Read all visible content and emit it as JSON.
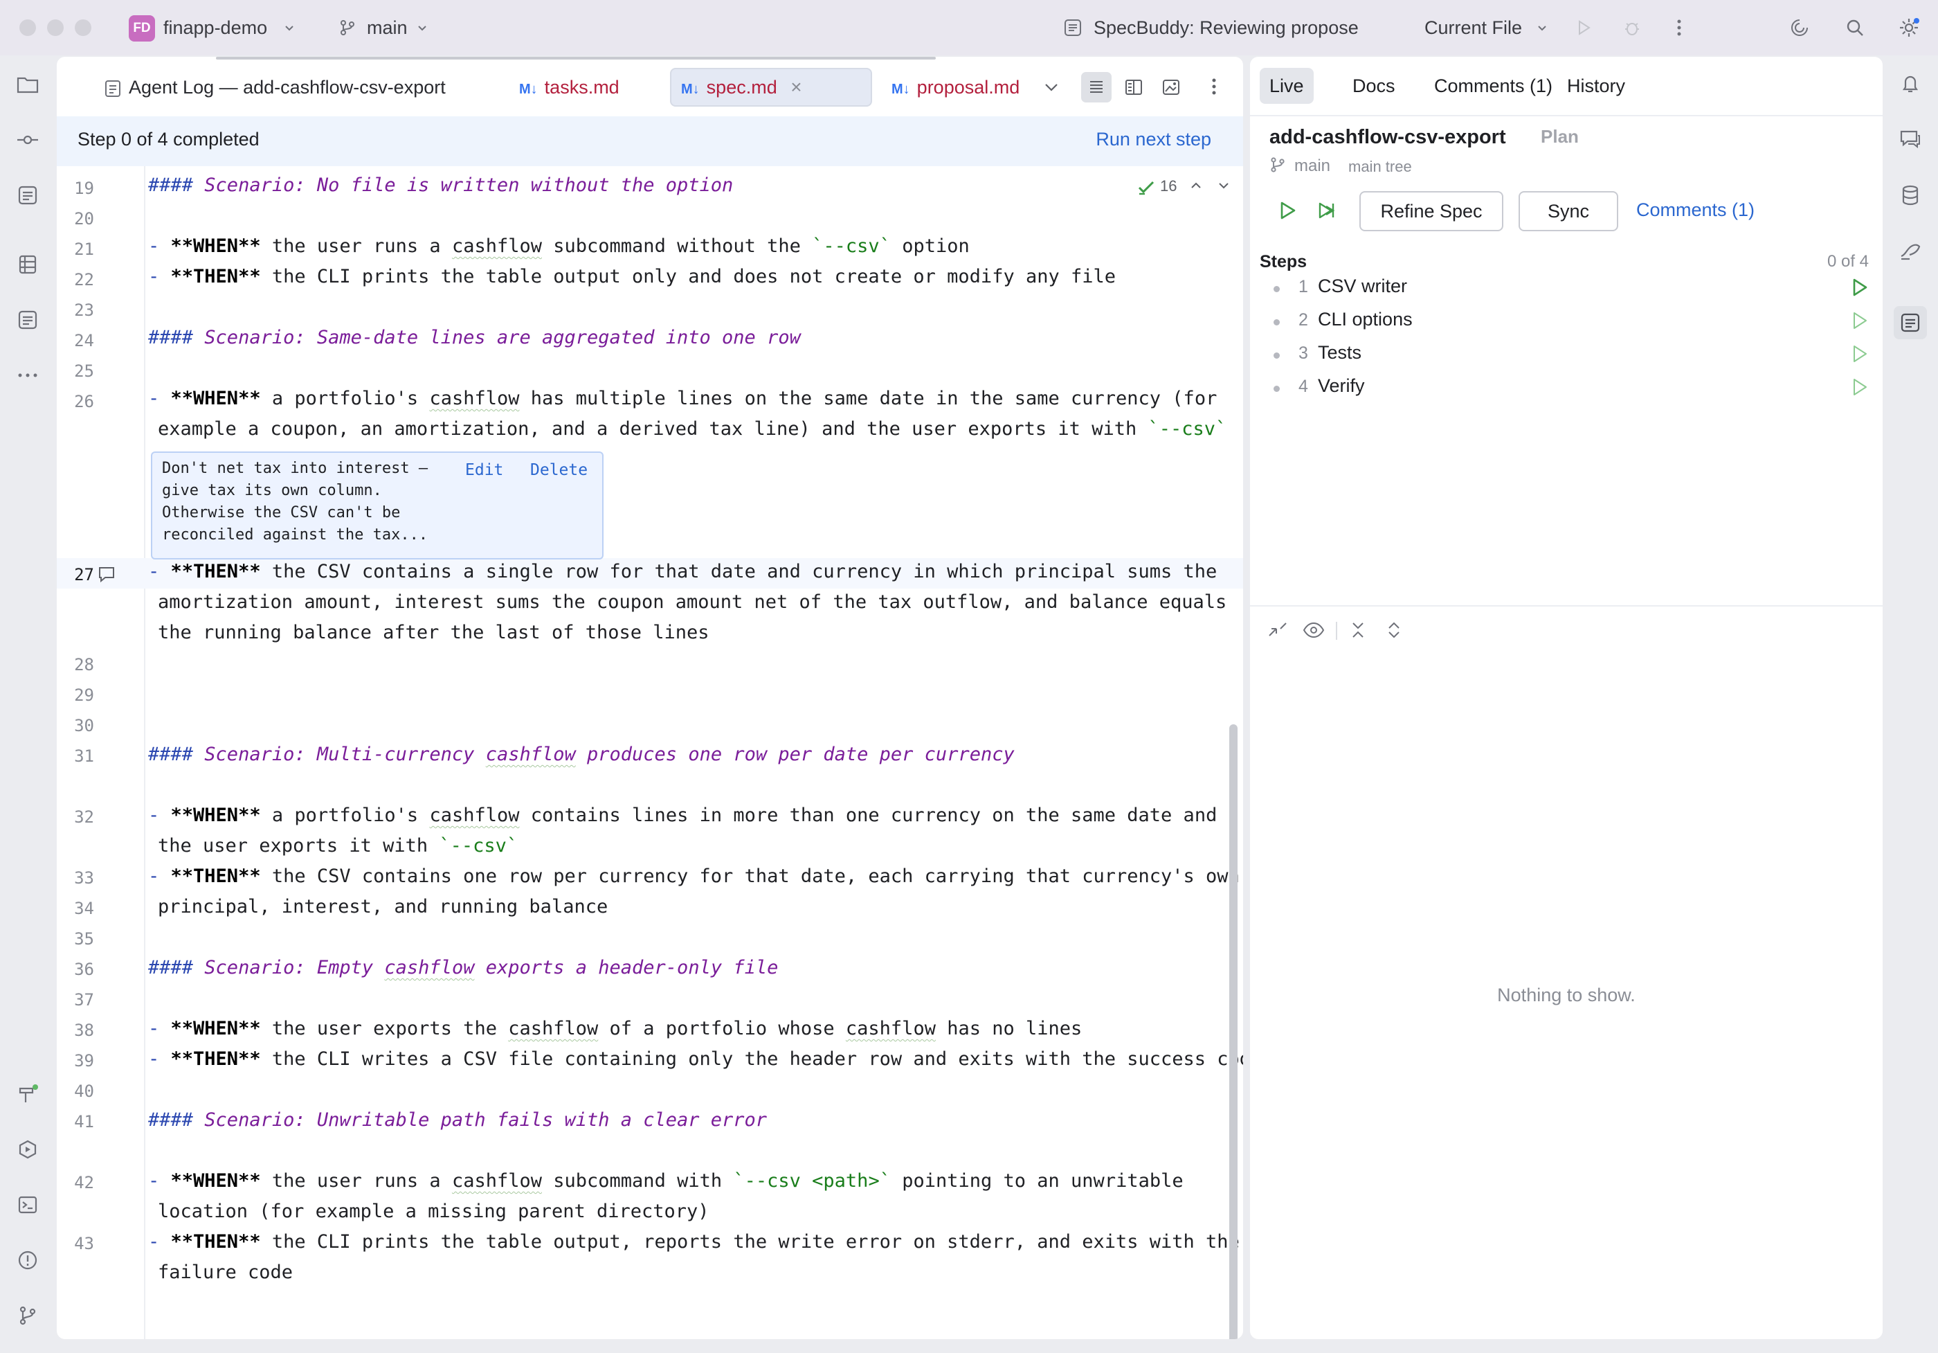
{
  "titlebar": {
    "project_initials": "FD",
    "project_name": "finapp-demo",
    "branch": "main",
    "run_config": "SpecBuddy: Reviewing propose",
    "run_target": "Current File"
  },
  "editor": {
    "tabs": [
      {
        "label": "Agent Log — add-cashflow-csv-export",
        "kind": "log"
      },
      {
        "label": "tasks.md",
        "kind": "md"
      },
      {
        "label": "spec.md",
        "kind": "md",
        "active": true
      },
      {
        "label": "proposal.md",
        "kind": "md"
      }
    ],
    "md_badge": "M↓",
    "close_glyph": "×",
    "step_status": "Step 0 of 4 completed",
    "run_next_step": "Run next step",
    "inspection_count": "16",
    "lines": {
      "l19": "19",
      "l20": "20",
      "l21": "21",
      "l22": "22",
      "l23": "23",
      "l24": "24",
      "l25": "25",
      "l26": "26",
      "l27": "27",
      "l28": "28",
      "l29": "29",
      "l30": "30",
      "l31": "31",
      "l32": "32",
      "l33": "33",
      "l34": "34",
      "l35": "35",
      "l36": "36",
      "l37": "37",
      "l38": "38",
      "l39": "39",
      "l40": "40",
      "l41": "41",
      "l42": "42",
      "l43": "43"
    },
    "md": {
      "h4": "####",
      "bullet": "-",
      "when": "**WHEN**",
      "then": "**THEN**"
    },
    "text": {
      "s19": "Scenario: No file is written without the option",
      "l21_a": "the user runs a",
      "cashflow": "cashflow",
      "l21_b": "subcommand without the",
      "csv_opt": "`--csv`",
      "l21_c": "option",
      "l22_a": "the CLI prints the table output only and does not create or modify any file",
      "s24": "Scenario: Same-date lines are aggregated into one row",
      "l26_a": "a portfolio's",
      "l26_b": "has multiple lines on the same date in the same currency (for",
      "l26_c": "example a coupon, an amortization, and a derived tax line) and the user exports it with",
      "l27_a": "the CSV contains a single row for that date and currency in which principal sums the",
      "l27_b": "amortization amount, interest sums the coupon amount net of the tax outflow, and balance equals",
      "l27_c": "the running balance after the last of those lines",
      "s29_a": "Scenario: Multi-currency",
      "s29_b": "produces one row per date per currency",
      "l31_a": "a portfolio's",
      "l31_b": "contains lines in more than one currency on the same date and",
      "l31_c": "the user exports it with",
      "l32_a": "the CSV contains one row per currency for that date, each carrying that currency's own",
      "l32_b": "principal, interest, and running balance",
      "s34_a": "Scenario: Empty",
      "s34_b": "exports a header-only file",
      "l36_a": "the user exports the",
      "l36_b": "of a portfolio whose",
      "l36_c": "has no lines",
      "l37_a": "the CLI writes a CSV file containing only the header row and exits with the success code",
      "s39": "Scenario: Unwritable path fails with a clear error",
      "l41_a": "the user runs a",
      "l41_b": "subcommand with",
      "csv_path": "`--csv <path>`",
      "l41_c": "pointing to an unwritable",
      "l41_d": "location (for example a missing parent directory)",
      "l42_a": "the CLI prints the table output, reports the write error on stderr, and exits with the",
      "l42_b": "failure code"
    },
    "comment": {
      "line1": "Don't net tax into interest —",
      "line2": "give tax its own column.",
      "line3": "Otherwise the CSV can't be",
      "line4": "reconciled against the tax...",
      "edit": "Edit",
      "delete": "Delete"
    }
  },
  "panel": {
    "tabs": [
      "Live",
      "Docs",
      "Comments (1)",
      "History"
    ],
    "title": "add-cashflow-csv-export",
    "badge": "Plan",
    "branch": "main",
    "tree": "main tree",
    "refine_spec": "Refine Spec",
    "sync": "Sync",
    "comments_link": "Comments (1)",
    "steps_header": "Steps",
    "steps_count": "0 of 4",
    "steps": [
      {
        "num": "1",
        "label": "CSV writer"
      },
      {
        "num": "2",
        "label": "CLI options"
      },
      {
        "num": "3",
        "label": "Tests"
      },
      {
        "num": "4",
        "label": "Verify"
      }
    ],
    "empty_text": "Nothing to show."
  },
  "colors": {
    "accent": "#3574f0",
    "run_green": "#3f9c48",
    "tab_text_red": "#b3203d",
    "heading_purple": "#7a1d99",
    "string_green": "#197d1a"
  }
}
